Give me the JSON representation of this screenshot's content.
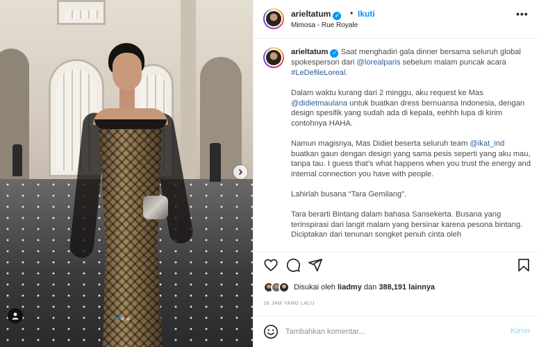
{
  "header": {
    "username": "arieltatum",
    "separator": "•",
    "follow_label": "Ikuti",
    "location": "Mimosa - Rue Royale"
  },
  "caption": {
    "username": "arieltatum",
    "p1_a": " Saat menghadiri gala dinner bersama seluruh global spokesperson dari ",
    "p1_mention": "@lorealparis",
    "p1_b": " sebelum malam puncak acara ",
    "p1_hashtag": "#LeDefileLoreal",
    "p1_c": ".",
    "p2_a": "Dalam waktu kurang dari 2 minggu, aku request ke Mas ",
    "p2_mention": "@didietmaulana",
    "p2_b": " untuk buatkan dress bernuansa Indonesia, dengan design spesifik yang sudah ada di kepala, eehhh lupa di kirim contohnya HAHA.",
    "p3_a": "Namun magisnya, Mas Didiet beserta seluruh team ",
    "p3_mention": "@ikat_ind",
    "p3_b": " buatkan gaun dengan design yang sama pesis seperti yang aku mau, tanpa tau. I guess that’s what happens when you trust the energy and internal connection you have with people.",
    "p4": "Lahirlah busana “Tara Gemilang”.",
    "p5": "Tara berarti Bintang dalam bahasa Sansekerta. Busana yang terinspirasi dari langit malam yang bersinar karena pesona bintang. Diciptakan dari tenunan songket penuh cinta oleh"
  },
  "likes": {
    "prefix": "Disukai oleh ",
    "user": "liadmy",
    "middle": " dan ",
    "count": "388,191 lainnya"
  },
  "timestamp": "18 JAM YANG LALU",
  "comment": {
    "placeholder": "Tambahkan komentar...",
    "send_label": "Kirim"
  },
  "carousel": {
    "slides": 3,
    "active_index": 0
  },
  "icons": [
    "heart-icon",
    "comment-icon",
    "share-icon",
    "bookmark-icon",
    "more-options-icon",
    "emoji-icon",
    "next-arrow-icon",
    "tag-user-icon",
    "verified-icon"
  ],
  "colors": {
    "accent": "#0095f6",
    "link": "#2b5e9c",
    "send_disabled": "#b2dffc",
    "border": "#efefef",
    "muted": "#8e8e8e"
  }
}
